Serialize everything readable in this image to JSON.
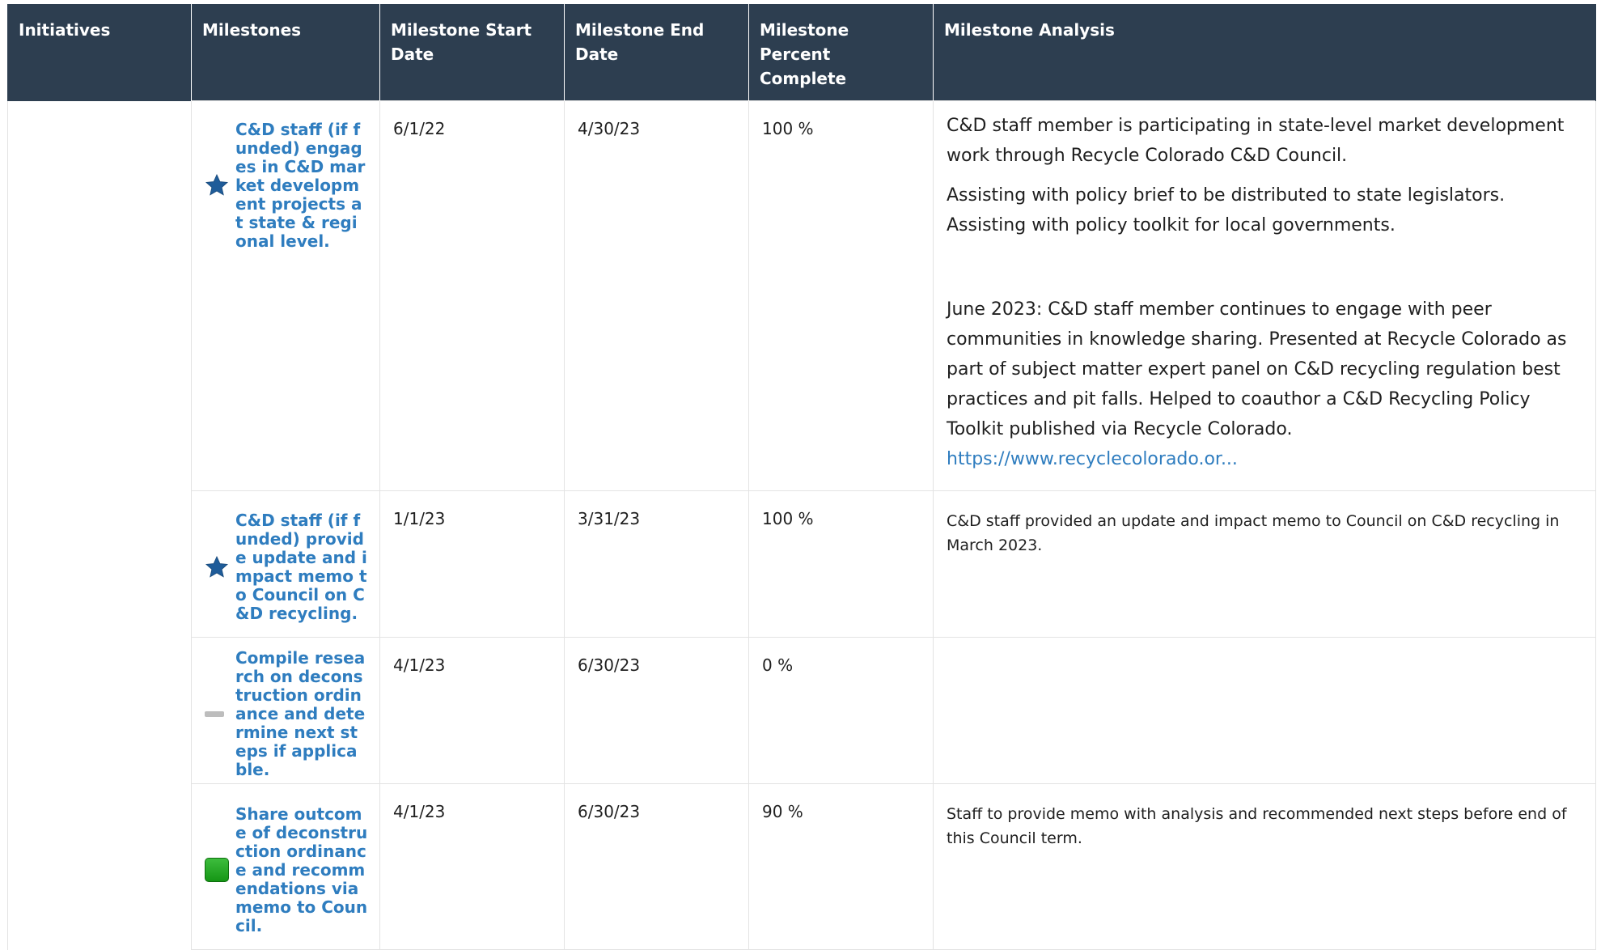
{
  "headers": {
    "initiatives": "Initiatives",
    "milestones": "Milestones",
    "start": "Milestone Start Date",
    "end": "Milestone End Date",
    "percent": "Milestone Percent Complete",
    "analysis": "Milestone Analysis"
  },
  "rows": [
    {
      "status": "star-icon",
      "milestone": "C&D staff (if funded) engages in C&D market development projects at state & regional level.",
      "start": "6/1/22",
      "end": "4/30/23",
      "percent": "100 %",
      "analysis": {
        "p1": "C&D staff member is participating in state-level market development work through Recycle Colorado C&D Council.",
        "p2": "Assisting with policy brief to be distributed to state legislators. Assisting with policy toolkit for local governments.",
        "p3": "June 2023: C&D staff member continues to engage with peer communities in knowledge sharing. Presented at Recycle Colorado as part of subject matter expert panel on C&D recycling regulation best practices and pit falls. Helped to coauthor a C&D Recycling Policy Toolkit published via Recycle Colorado.",
        "link": "https://www.recyclecolorado.or..."
      }
    },
    {
      "status": "star-icon",
      "milestone": "C&D staff (if funded) provide update and impact memo to Council on C&D recycling.",
      "start": "1/1/23",
      "end": "3/31/23",
      "percent": "100 %",
      "analysis": "C&D staff provided an update and impact memo to Council on C&D recycling in March 2023."
    },
    {
      "status": "dash-icon",
      "milestone": "Compile research on deconstruction ordinance and determine next steps if applicable.",
      "start": "4/1/23",
      "end": "6/30/23",
      "percent": "0 %",
      "analysis": ""
    },
    {
      "status": "green-status-icon",
      "milestone": "Share outcome of deconstruction ordinance and recommendations via memo to Council.",
      "start": "4/1/23",
      "end": "6/30/23",
      "percent": "90 %",
      "analysis": "Staff to provide memo with analysis and recommended next steps before end of this Council term."
    }
  ],
  "colors": {
    "header_bg": "#2d3e50",
    "link": "#2f7dbf",
    "star": "#1f5c99",
    "status_green": "#1ea51e",
    "status_gray": "#bdbdbd"
  }
}
